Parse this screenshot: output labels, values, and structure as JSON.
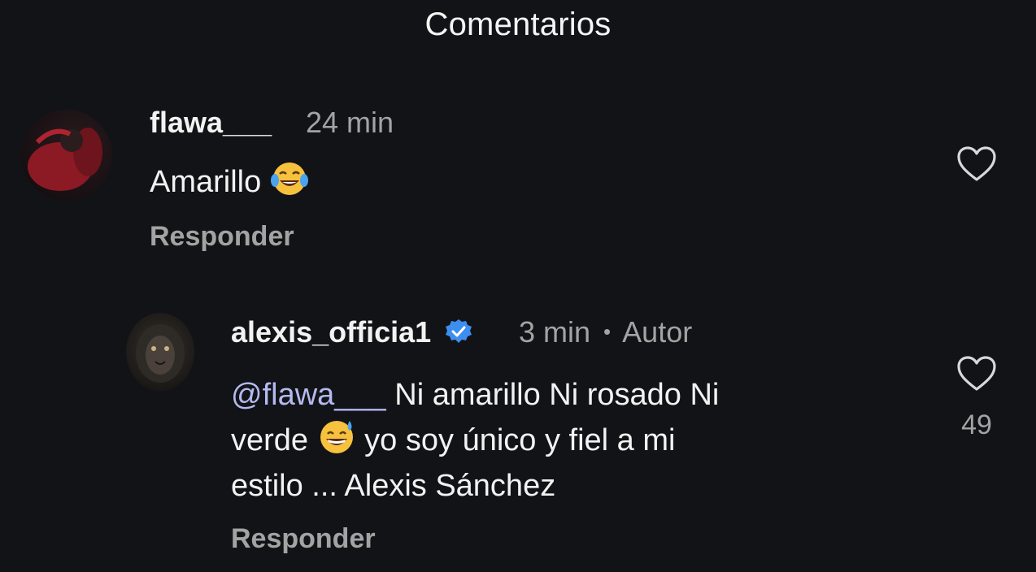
{
  "header": {
    "title": "Comentarios"
  },
  "comments": [
    {
      "username": "flawa___",
      "time": "24 min",
      "text": "Amarillo",
      "emoji_icon": "tears-of-joy-emoji",
      "reply_label": "Responder"
    },
    {
      "username": "alexis_officia1",
      "verified_icon": "verified-badge-icon",
      "time": "3 min",
      "separator": "•",
      "author_tag": "Autor",
      "mention": "@flawa___",
      "text_part1": " Ni amarillo Ni rosado Ni",
      "text_part2": "verde",
      "emoji_icon": "grinning-sweat-emoji",
      "text_part3": " yo soy único y  fiel a mi",
      "text_part4": "estilo ... Alexis Sánchez",
      "reply_label": "Responder",
      "like_count": "49"
    }
  ],
  "colors": {
    "background": "#121316",
    "text": "#f2f2f2",
    "muted": "#a3a3a3",
    "mention": "#b4b9f0",
    "verified": "#3d8ef0"
  }
}
